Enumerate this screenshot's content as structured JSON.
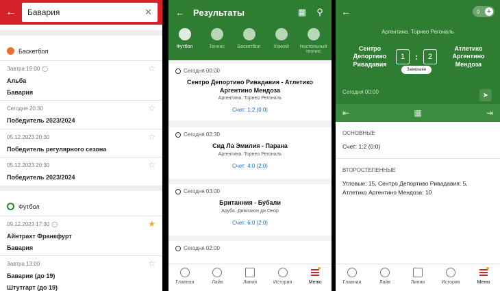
{
  "screen1": {
    "search_value": "Бавария",
    "sections": [
      {
        "sport": "Баскетбол",
        "items": [
          {
            "date": "Завтра 19:00",
            "lines": [
              "Альба",
              "Бавария"
            ],
            "fav": false
          },
          {
            "date": "Сегодня 20:30",
            "lines": [
              "Победитель 2023/2024"
            ],
            "fav": false
          },
          {
            "date": "05.12.2023 20:30",
            "lines": [
              "Победитель регулярного сезона"
            ],
            "fav": false
          },
          {
            "date": "05.12.2023 20:30",
            "lines": [
              "Победитель 2023/2024"
            ],
            "fav": false
          }
        ]
      },
      {
        "sport": "Футбол",
        "items": [
          {
            "date": "09.12.2023 17:30",
            "lines": [
              "Айнтрахт Франкфурт",
              "Бавария"
            ],
            "fav": true
          },
          {
            "date": "Завтра 13:00",
            "lines": [
              "Бавария (до 19)",
              "Штутгарт (до 19)"
            ],
            "fav": false
          }
        ]
      }
    ]
  },
  "screen2": {
    "title": "Результаты",
    "tabs": [
      "Футбол",
      "Теннис",
      "Баскетбол",
      "Хоккей",
      "Настольный теннис"
    ],
    "active_tab": "Футбол",
    "matches": [
      {
        "date": "Сегодня 00:00",
        "teams": "Сентро Депортиво Ривадавия - Атлетико Аргентино Мендоза",
        "league": "Аргентина. Торнео Регональ",
        "score": "Счет: 1:2 (0:0)"
      },
      {
        "date": "Сегодня 02:30",
        "teams": "Сид Ла Эмилия - Парана",
        "league": "Аргентина. Торнео Регональ",
        "score": "Счет: 4:0 (2:0)"
      },
      {
        "date": "Сегодня 03:00",
        "teams": "Британния - Бубали",
        "league": "Аруба. Дивизион ди Онор",
        "score": "Счет: 6:0 (2:0)"
      },
      {
        "date": "Сегодня 02:00",
        "teams": "",
        "league": "",
        "score": ""
      }
    ]
  },
  "navbar": {
    "items": [
      "Главная",
      "Лайв",
      "Линия",
      "История",
      "Меню"
    ]
  },
  "screen3": {
    "toggle_value": "0",
    "league": "Аргентина. Торнео Регональ",
    "team_left": "Сентро Депортиво Ривадавия",
    "team_right": "Атлетико Аргентино Мендоза",
    "score_left": "1",
    "score_right": "2",
    "status": "Завершен",
    "date": "Сегодня 00:00",
    "main_title": "ОСНОВНЫЕ",
    "main_text": "Счет: 1:2 (0:0)",
    "secondary_title": "ВТОРОСТЕПЕННЫЕ",
    "secondary_text": "Угловые: 15, Сентро Депортиво Ривадавия: 5, Атлетико Аргентино Мендоза: 10"
  }
}
